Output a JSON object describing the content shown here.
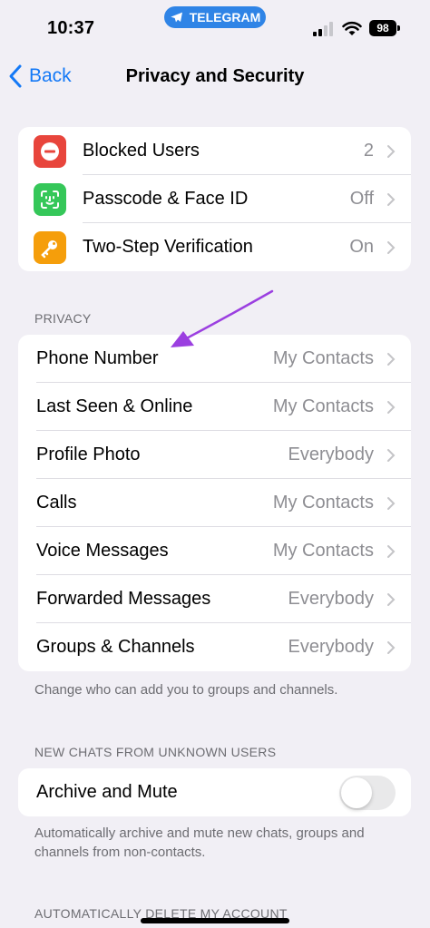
{
  "status_bar": {
    "time": "10:37",
    "app_pill": "TELEGRAM",
    "battery": "98"
  },
  "nav": {
    "back_label": "Back",
    "title": "Privacy and Security"
  },
  "security": {
    "items": [
      {
        "label": "Blocked Users",
        "value": "2",
        "icon": "minus-circle-icon",
        "color": "#e8453c"
      },
      {
        "label": "Passcode & Face ID",
        "value": "Off",
        "icon": "face-id-icon",
        "color": "#35c759"
      },
      {
        "label": "Two-Step Verification",
        "value": "On",
        "icon": "key-icon",
        "color": "#f59e0b"
      }
    ]
  },
  "privacy": {
    "header": "PRIVACY",
    "items": [
      {
        "label": "Phone Number",
        "value": "My Contacts"
      },
      {
        "label": "Last Seen & Online",
        "value": "My Contacts"
      },
      {
        "label": "Profile Photo",
        "value": "Everybody"
      },
      {
        "label": "Calls",
        "value": "My Contacts"
      },
      {
        "label": "Voice Messages",
        "value": "My Contacts"
      },
      {
        "label": "Forwarded Messages",
        "value": "Everybody"
      },
      {
        "label": "Groups & Channels",
        "value": "Everybody"
      }
    ],
    "footer": "Change who can add you to groups and channels."
  },
  "new_chats": {
    "header": "NEW CHATS FROM UNKNOWN USERS",
    "archive_label": "Archive and Mute",
    "archive_enabled": false,
    "footer": "Automatically archive and mute new chats, groups and channels from non-contacts."
  },
  "delete_account": {
    "header": "AUTOMATICALLY DELETE MY ACCOUNT"
  },
  "colors": {
    "accent": "#1479f6",
    "background": "#f1eff5",
    "annotation_arrow": "#9b3fe0"
  }
}
